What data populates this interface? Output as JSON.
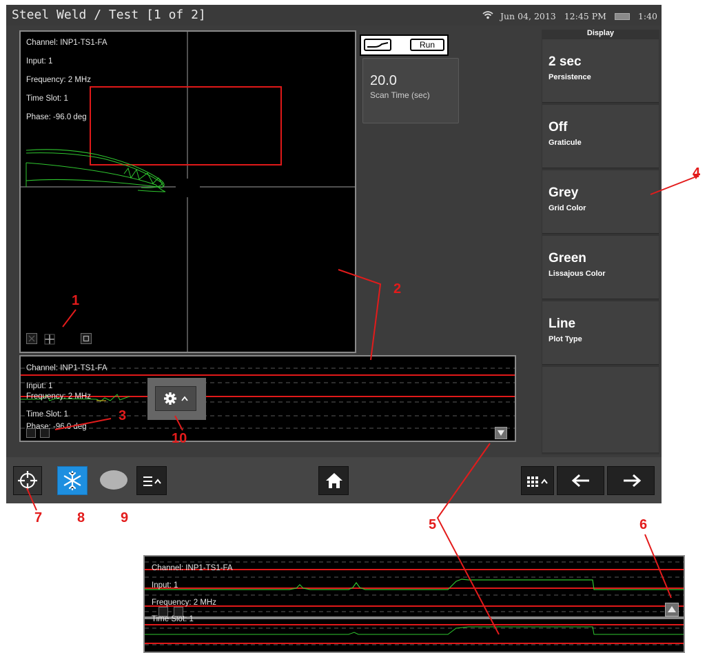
{
  "header": {
    "title": "Steel Weld / Test  [1 of 2]",
    "date": "Jun 04, 2013",
    "time": "12:45 PM",
    "battery_time": "1:40"
  },
  "lissajous": {
    "info": [
      "Channel: INP1-TS1-FA",
      "Input: 1",
      "Frequency: 2 MHz",
      "Time Slot: 1",
      "Phase: -96.0 deg"
    ],
    "trace_color": "#2fc72f",
    "box_color": "#e01919"
  },
  "strip": {
    "info": [
      "Channel: INP1-TS1-FA",
      "Input: 1",
      "Frequency: 2 MHz",
      "Time Slot: 1",
      "Phase: -96.0 deg"
    ]
  },
  "run": {
    "label": "Run"
  },
  "scan": {
    "value": "20.0",
    "label": "Scan Time (sec)"
  },
  "display_panel": {
    "title": "Display",
    "items": [
      {
        "value": "2 sec",
        "label": "Persistence"
      },
      {
        "value": "Off",
        "label": "Graticule"
      },
      {
        "value": "Grey",
        "label": "Grid Color"
      },
      {
        "value": "Green",
        "label": "Lissajous Color"
      },
      {
        "value": "Line",
        "label": "Plot Type"
      }
    ]
  },
  "bottom_bar": {
    "icons": [
      "crosshair-icon",
      "snowflake-icon",
      "ellipse-icon",
      "menu-icon",
      "home-icon",
      "grid-icon",
      "arrow-left-icon",
      "arrow-right-icon"
    ]
  },
  "inset": {
    "info": [
      "Channel: INP1-TS1-FA",
      "Input: 1",
      "Frequency: 2 MHz",
      "Time Slot: 1"
    ]
  },
  "callouts": [
    "1",
    "2",
    "3",
    "4",
    "5",
    "6",
    "7",
    "8",
    "9",
    "10"
  ],
  "colors": {
    "callout": "#e31b1b",
    "trace": "#2fc72f",
    "red_line": "#e01919",
    "snowflake_bg": "#1e8fe0"
  }
}
